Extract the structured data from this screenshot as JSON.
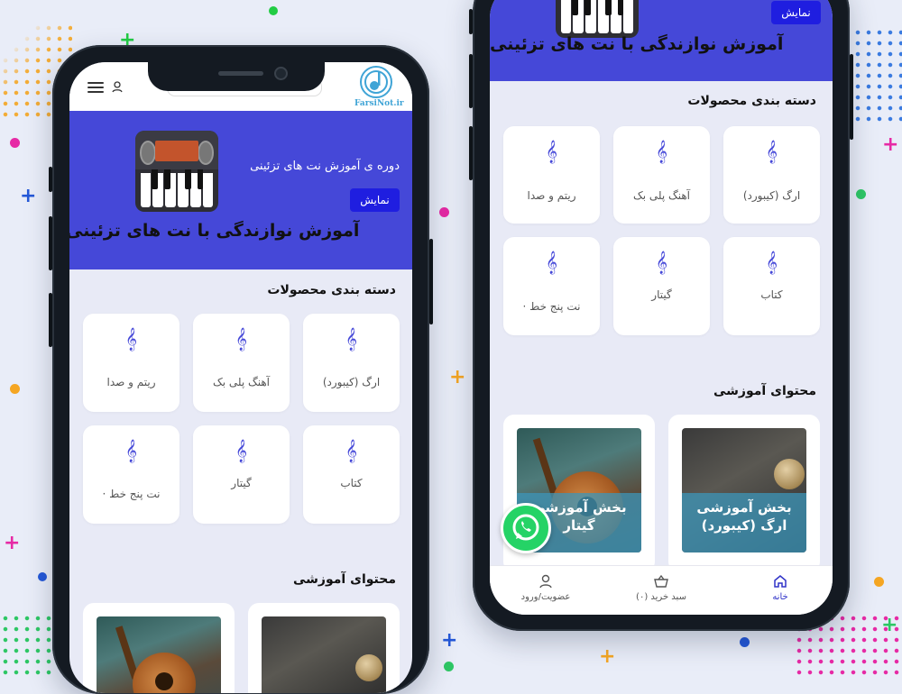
{
  "brand": {
    "logo_text": "FarsiNot.ir"
  },
  "hero": {
    "subtitle": "دوره ی آموزش نت های تزئینی",
    "title": "آموزش نوازندگی با نت های تزئینی",
    "show_button": "نمایش"
  },
  "categories": {
    "title": "دسته بندی محصولات",
    "items": [
      {
        "label": "ارگ (کیبورد)",
        "icon": "treble-clef-icon"
      },
      {
        "label": "آهنگ پلی بک",
        "icon": "treble-clef-icon"
      },
      {
        "label": "ریتم و صدا",
        "icon": "treble-clef-icon"
      },
      {
        "label": "کتاب",
        "icon": "treble-clef-icon"
      },
      {
        "label": "گیتار",
        "icon": "treble-clef-icon"
      },
      {
        "label": "نت پنج خط ·",
        "icon": "treble-clef-icon"
      }
    ]
  },
  "education": {
    "title": "محتوای آموزشی",
    "items": [
      {
        "caption_line1": "بخش آموزشی",
        "caption_line2": "ارگ (کیبورد)"
      },
      {
        "caption_line1": "بخش آموزشی",
        "caption_line2": "گیتار"
      }
    ]
  },
  "bottom_nav": {
    "home": "خانه",
    "cart": "سبد خرید (۰)",
    "account": "عضویت/ورود"
  },
  "colors": {
    "primary": "#4548d8",
    "button": "#1f1ee0",
    "background": "#e8eaf6",
    "whatsapp": "#25d366"
  }
}
